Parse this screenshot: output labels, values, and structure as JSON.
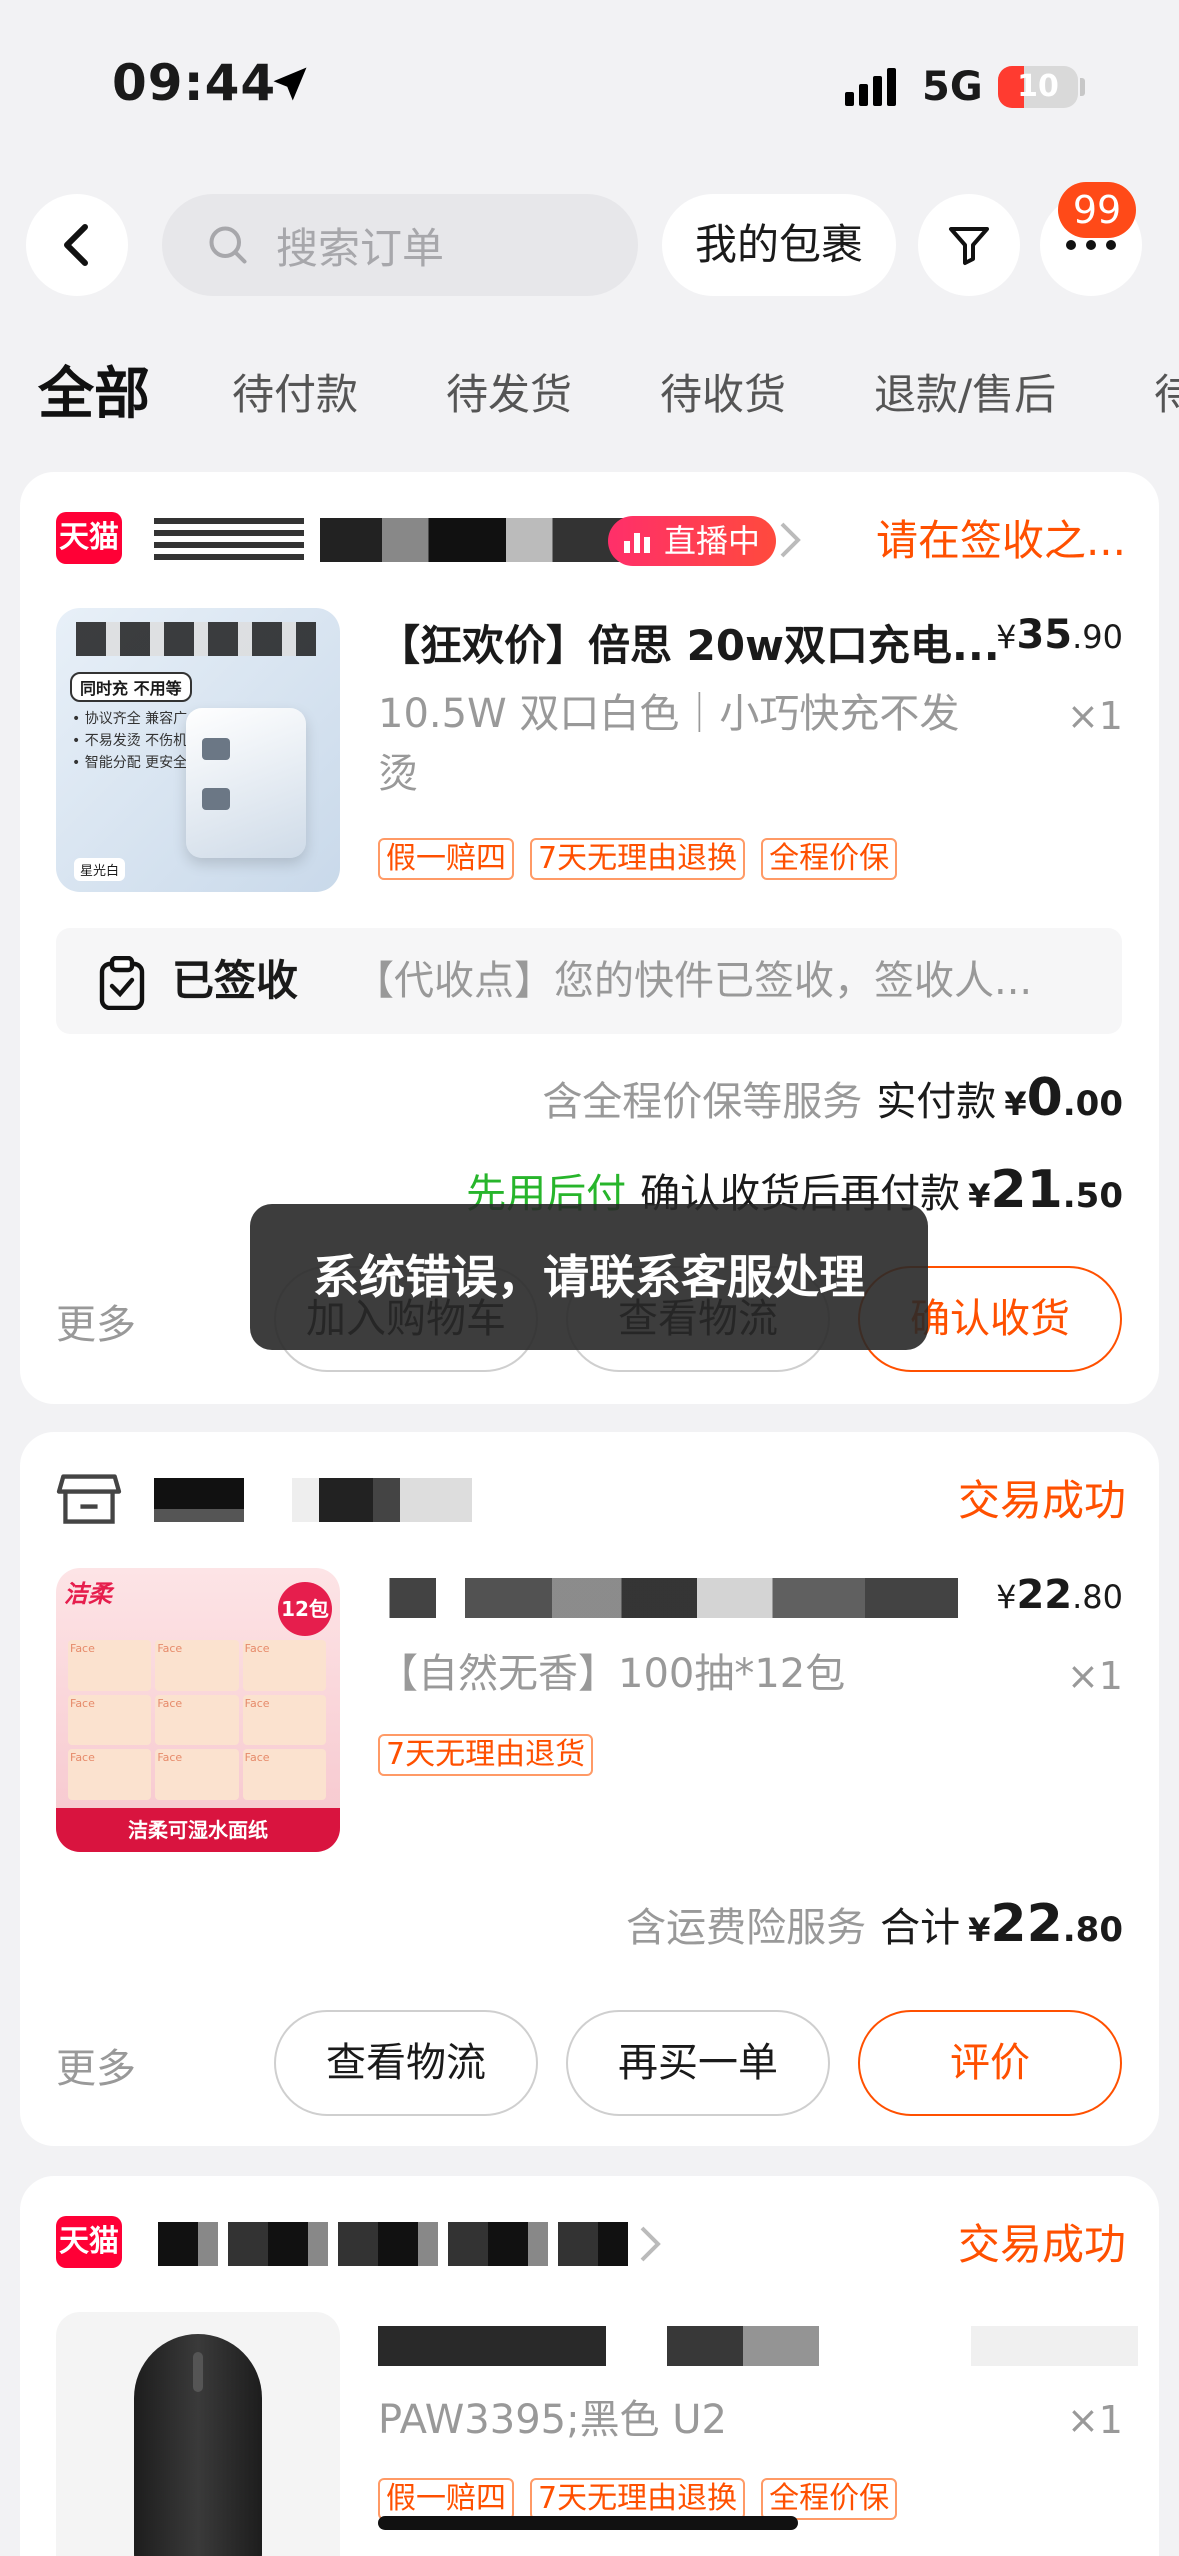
{
  "status_bar": {
    "time": "09:44",
    "network": "5G",
    "battery": "10"
  },
  "header": {
    "search_placeholder": "搜索订单",
    "packages_label": "我的包裹",
    "badge_count": "99"
  },
  "tabs": [
    "全部",
    "待付款",
    "待发货",
    "待收货",
    "退款/售后",
    "待"
  ],
  "orders": [
    {
      "store_badge": "天猫",
      "live_tag": "直播中",
      "status": "请在签收之...",
      "title": "【狂欢价】倍思 20w双口充电...",
      "spec": "10.5W 双口白色｜小巧快充不发烫",
      "price_int": "35",
      "price_dec": ".90",
      "qty": "×1",
      "tags": [
        "假一赔四",
        "7天无理由退换",
        "全程价保"
      ],
      "logistics_status": "已签收",
      "logistics_text": "【代收点】您的快件已签收，签收人...",
      "service_note": "含全程价保等服务",
      "paid_label": "实付款",
      "paid_int": "0",
      "paid_dec": ".00",
      "pay_later": "先用后付",
      "confirm_note": "确认收货后再付款",
      "later_int": "21",
      "later_dec": ".50",
      "more": "更多",
      "buttons": [
        "加入购物车",
        "查看物流",
        "确认收货"
      ],
      "thumb_text": {
        "badge": "同时充 不用等",
        "lines": [
          "• 协议齐全 兼容广",
          "• 不易发烫 不伤机",
          "• 智能分配 更安全"
        ],
        "color_label": "星光白"
      }
    },
    {
      "status": "交易成功",
      "spec": "【自然无香】100抽*12包",
      "price_int": "22",
      "price_dec": ".80",
      "qty": "×1",
      "tags": [
        "7天无理由退货"
      ],
      "service_note": "含运费险服务",
      "total_label": "合计",
      "total_int": "22",
      "total_dec": ".80",
      "more": "更多",
      "buttons": [
        "查看物流",
        "再买一单",
        "评价"
      ],
      "thumb_text": {
        "brand": "洁柔",
        "pack": "12包",
        "product": "Face",
        "bottom": "洁柔可湿水面纸"
      }
    },
    {
      "store_badge": "天猫",
      "status": "交易成功",
      "spec": "PAW3395;黑色 U2",
      "qty": "×1",
      "tags": [
        "假一赔四",
        "7天无理由退换",
        "全程价保"
      ]
    }
  ],
  "toast": "系统错误，请联系客服处理",
  "colors": {
    "accent": "#ff5000",
    "tmall": "#ff0036",
    "green": "#27b52b"
  }
}
